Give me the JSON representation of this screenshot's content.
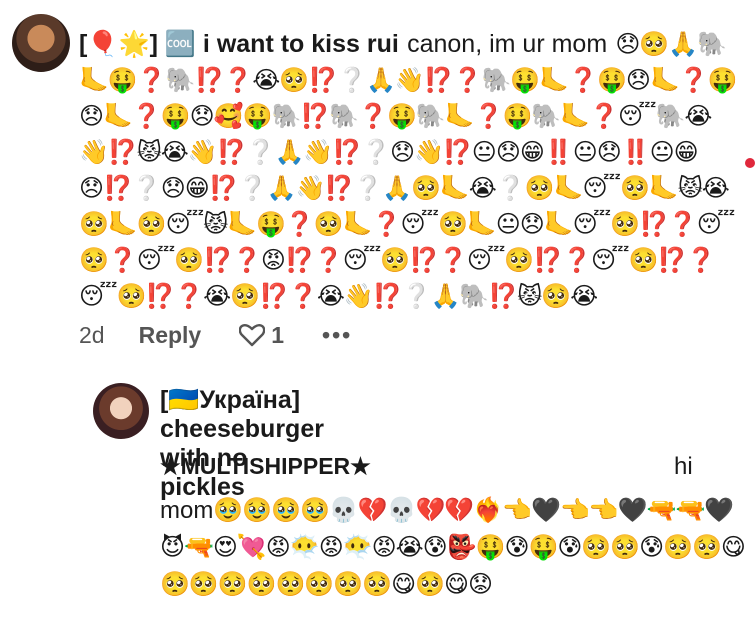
{
  "comment1": {
    "author": "[🎈🌟] 🆒 i want to kiss rui",
    "text": "canon, im ur mom",
    "emojis": "😞🥺🙏🐘🦶🤑❓🐘⁉️❓😭🥺⁉️❔🙏👋⁉️❓🐘🤑🦶❓🤑😞🦶❓🤑😞🦶❓🤑😞🥰🤑🐘⁉️🐘❓🤑🐘🦶❓🤑🐘🦶❓😴🐘😭👋⁉️😾😭👋⁉️❔🙏👋⁉️❔😞👋⁉️😐😞😁‼️😐😞‼️😐😁😞⁉️❔😞😁⁉️❔🙏👋⁉️❔🙏🥺🦶😭❔🥺🦶😴🥺🦶😾😭🥺🦶🥺😴😾🦶🤑❓🥺🦶❓😴🥺🦶😐😞🦶😴🥺⁉️❓😴🥺❓😴🥺⁉️❓😡⁉️❓😴🥺⁉️❓😴🥺⁉️❓😴🥺⁉️❓😴🥺⁉️❓😭🥺⁉️❓😭👋⁉️❔🙏🐘⁉️😾🥺😭",
    "time": "2d",
    "reply_label": "Reply",
    "likes": "1",
    "more_label": "•••"
  },
  "comment2": {
    "author": "[🇺🇦Україна] cheeseburger with no pickles",
    "tag": "★MULTISHIPPER★",
    "hi": "hi",
    "text": "mom",
    "emojis": "🥹🥹🥹🥹💀💔💀💔💔❤️‍🔥👈🖤👈👈🖤🔫🔫🖤😈🔫😍💘😡😶‍🌫️😡😶‍🌫️😡😭😰👺🤑😰🤑😰🥺🥺😰🥺🥺😋🥺🥺🥺🥺🥺🥺🥺🥺😋🥺😋😟"
  },
  "colors": {
    "notification_dot": "#e0283c",
    "secondary_text": "#555555"
  }
}
